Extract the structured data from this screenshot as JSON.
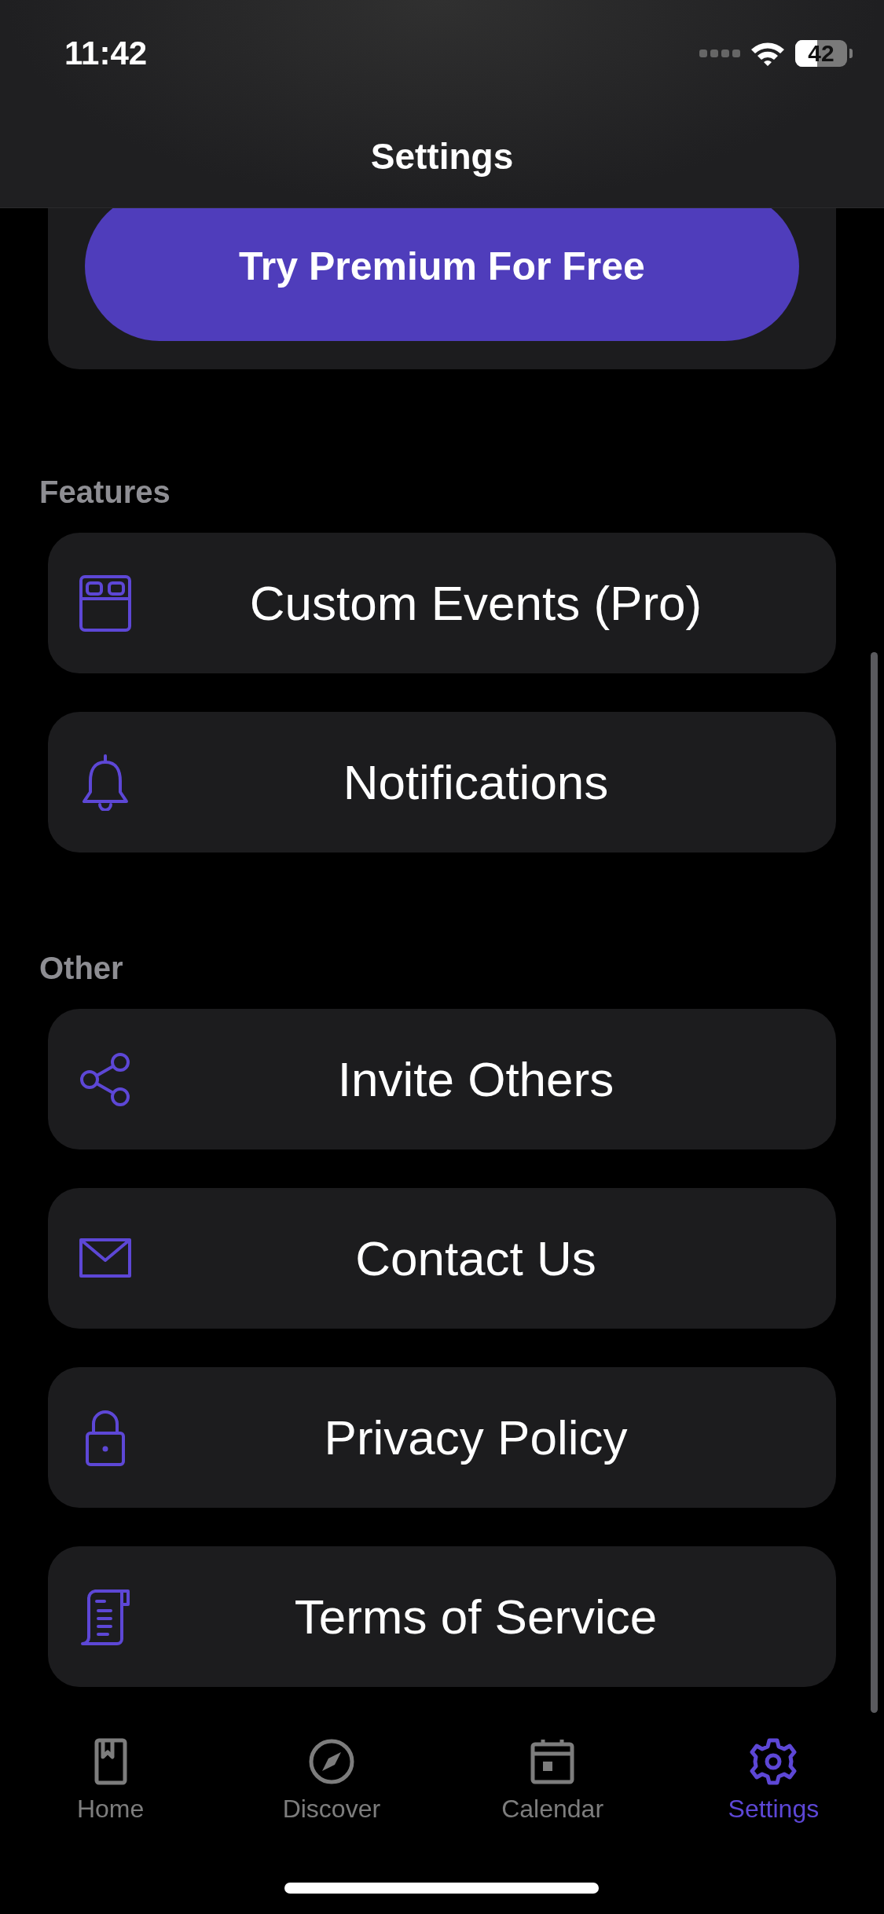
{
  "status_bar": {
    "time": "11:42",
    "battery": "42"
  },
  "navigation": {
    "title": "Settings"
  },
  "premium_button": {
    "label": "Try Premium For Free"
  },
  "sections": [
    {
      "title": "Features",
      "items": [
        {
          "label": "Custom Events (Pro)"
        },
        {
          "label": "Notifications"
        }
      ]
    },
    {
      "title": "Other",
      "items": [
        {
          "label": "Invite Others"
        },
        {
          "label": "Contact Us"
        },
        {
          "label": "Privacy Policy"
        },
        {
          "label": "Terms of Service"
        }
      ]
    }
  ],
  "tab_bar": [
    {
      "label": "Home",
      "selected": false
    },
    {
      "label": "Discover",
      "selected": false
    },
    {
      "label": "Calendar",
      "selected": false
    },
    {
      "label": "Settings",
      "selected": true
    }
  ]
}
